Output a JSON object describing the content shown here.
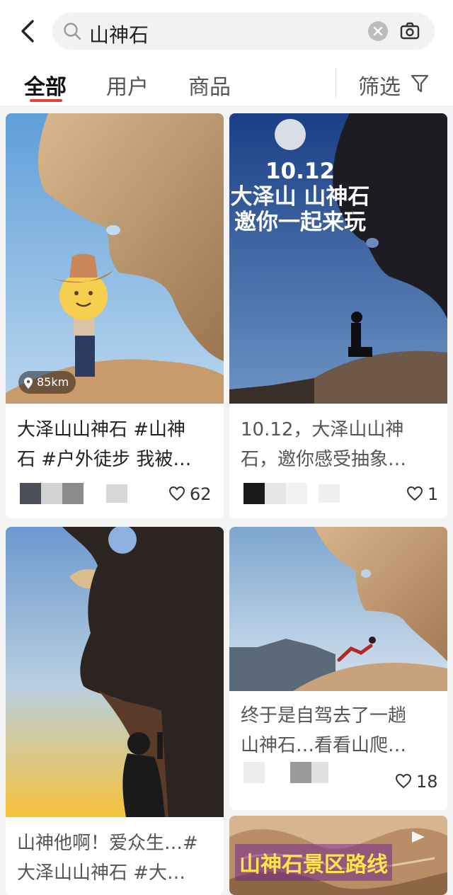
{
  "search": {
    "query": "山神石"
  },
  "tabs": [
    {
      "label": "全部"
    },
    {
      "label": "用户"
    },
    {
      "label": "商品"
    }
  ],
  "filter": {
    "label": "筛选"
  },
  "cards": [
    {
      "title": "大泽山山神石 #山神\n石 #户外徒步 我被…",
      "likes": "62",
      "distance": "85km"
    },
    {
      "title": "10.12，大泽山山神\n石，邀你感受抽象…",
      "likes": "1",
      "overlay_lines": [
        "10.12",
        "大泽山 山神石",
        "邀你一起来玩"
      ]
    },
    {
      "title": "山神他啊！爱众生…#\n大泽山山神石 #大…"
    },
    {
      "title": "终于是自驾去了一趟\n山神石…看看山爬…",
      "likes": "18"
    },
    {
      "banner": "山神石景区路线"
    }
  ],
  "colors": {
    "accent": "#e8413b"
  }
}
